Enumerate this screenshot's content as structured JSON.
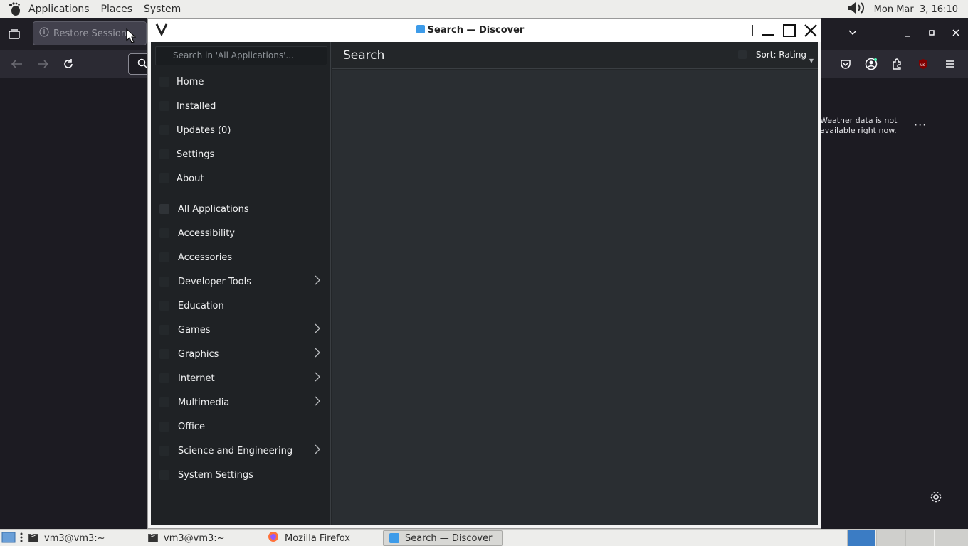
{
  "top_panel": {
    "menus": [
      "Applications",
      "Places",
      "System"
    ],
    "datetime": "Mon Mar  3, 16:10"
  },
  "firefox": {
    "restore_tab_label": "Restore Session",
    "weather_text": "Weather data is not available right now.",
    "more_label": "···"
  },
  "discover": {
    "window_title": "Search — Discover",
    "search_placeholder": "Search in 'All Applications'...",
    "page_title": "Search",
    "sort_label": "Sort: Rating",
    "nav_items": [
      {
        "label": "Home"
      },
      {
        "label": "Installed"
      },
      {
        "label": "Updates (0)"
      },
      {
        "label": "Settings"
      },
      {
        "label": "About"
      }
    ],
    "categories": [
      {
        "label": "All Applications",
        "has_children": false
      },
      {
        "label": "Accessibility",
        "has_children": false
      },
      {
        "label": "Accessories",
        "has_children": false
      },
      {
        "label": "Developer Tools",
        "has_children": true
      },
      {
        "label": "Education",
        "has_children": false
      },
      {
        "label": "Games",
        "has_children": true
      },
      {
        "label": "Graphics",
        "has_children": true
      },
      {
        "label": "Internet",
        "has_children": true
      },
      {
        "label": "Multimedia",
        "has_children": true
      },
      {
        "label": "Office",
        "has_children": false
      },
      {
        "label": "Science and Engineering",
        "has_children": true
      },
      {
        "label": "System Settings",
        "has_children": false
      }
    ]
  },
  "taskbar": {
    "tasks": [
      {
        "label": "vm3@vm3:~"
      },
      {
        "label": "vm3@vm3:~"
      },
      {
        "label": "Mozilla Firefox"
      },
      {
        "label": "Search — Discover"
      }
    ]
  },
  "colors": {
    "panel_bg": "#ededeb",
    "discover_sidebar": "#1f2225",
    "discover_content": "#2a2e32",
    "firefox_bg": "#1c1b22",
    "workspace_active": "#3b7cc4"
  }
}
